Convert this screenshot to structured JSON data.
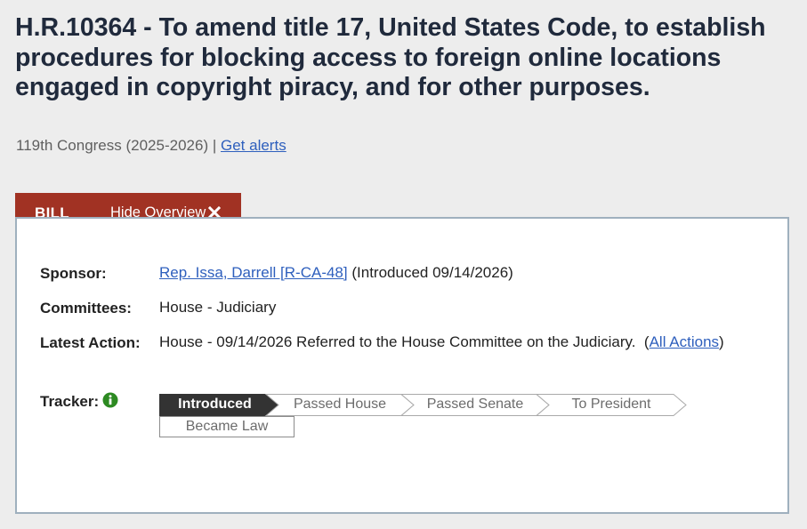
{
  "bill": {
    "title": "H.R.10364 - To amend title 17, United States Code, to establish procedures for blocking access to foreign online locations engaged in copyright piracy, and for other purposes.",
    "congress": "119th Congress (2025-2026)",
    "separator": "|",
    "alerts_link": "Get alerts"
  },
  "tabs": {
    "bill_label": "BILL",
    "hide_overview_label": "Hide Overview"
  },
  "overview": {
    "sponsor_label": "Sponsor:",
    "sponsor_link": "Rep. Issa, Darrell [R-CA-48]",
    "sponsor_intro": "(Introduced 09/14/2026)",
    "committees_label": "Committees:",
    "committees_value": "House - Judiciary",
    "latest_action_label": "Latest Action:",
    "latest_action_text": "House - 09/14/2026 Referred to the House Committee on the Judiciary.",
    "all_actions_link": "All Actions",
    "tracker_label": "Tracker:"
  },
  "tracker": {
    "steps": [
      "Introduced",
      "Passed House",
      "Passed Senate",
      "To President"
    ],
    "final_step": "Became Law",
    "current_step": "Introduced",
    "current_color": "#333333"
  },
  "icons": {
    "close": "close-x-icon",
    "info": "info-circle-icon"
  }
}
